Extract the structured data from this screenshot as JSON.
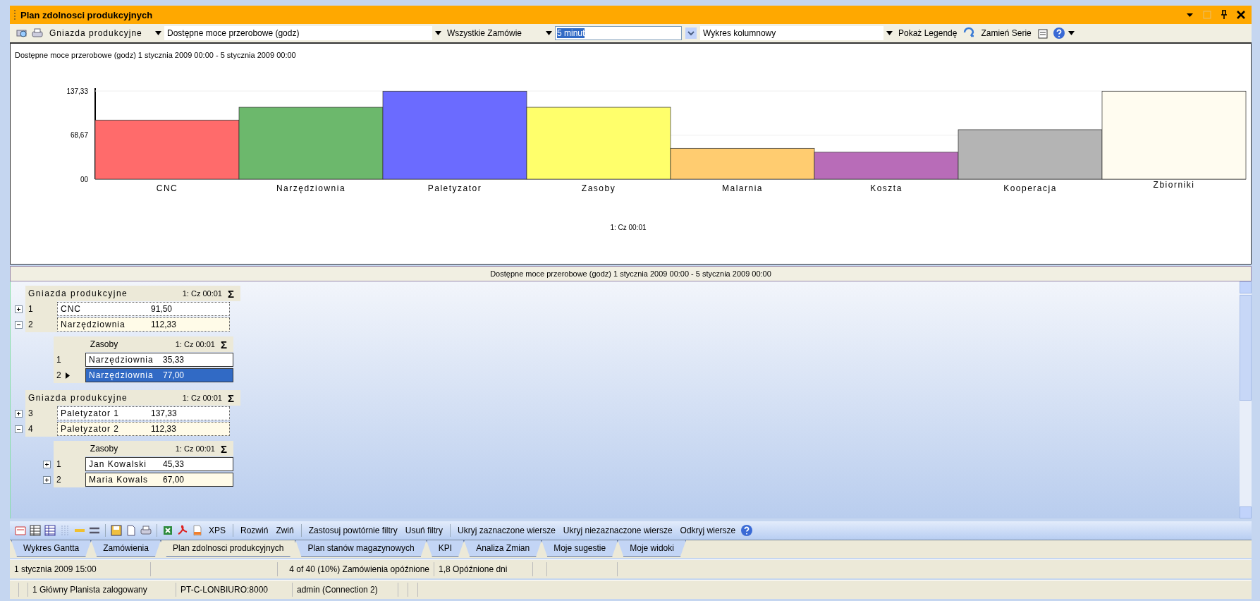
{
  "window": {
    "title": "Plan zdolnosci produkcyjnych"
  },
  "toolbar": {
    "group_by": "Gniazda produkcyjne",
    "measure": "Dostępne moce przerobowe (godz)",
    "orders": "Wszystkie Zamówie",
    "interval": "5 minut",
    "chart_type": "Wykres kolumnowy",
    "buttons": [
      "Pokaż Legendę",
      "Zamień Serie"
    ]
  },
  "chart": {
    "title": "Dostępne moce przerobowe (godz) 1 stycznia 2009  00:00 - 5 stycznia 2009  00:00",
    "chart_data": {
      "type": "bar",
      "categories": [
        "CNC",
        "Narzędziownia",
        "Paletyzator",
        "Zasoby",
        "Malarnia",
        "Koszta",
        "Kooperacja",
        "Zbiorniki"
      ],
      "series": [
        {
          "name": "1: Cz 00:01",
          "colors": [
            "#ff6b6b",
            "#6cb86c",
            "#6b6bff",
            "#ffff6b",
            "#ffcc70",
            "#b86cb8",
            "#b4b4b4",
            "#fffcf0"
          ],
          "values": [
            92,
            112,
            137,
            112,
            48,
            42,
            77,
            137
          ]
        }
      ],
      "ylim": [
        0,
        137.33
      ],
      "yticks": [
        {
          "value": 0,
          "label": "00"
        },
        {
          "value": 68.67,
          "label": "68,67"
        },
        {
          "value": 137.33,
          "label": "137,33"
        }
      ]
    }
  },
  "grid": {
    "caption": "Dostępne moce przerobowe (godz) 1 stycznia 2009  00:00 - 5 stycznia 2009  00:00",
    "groups": [
      {
        "header": {
          "title": "Gniazda produkcyjne",
          "column": "1: Cz 00:01",
          "sigma": "Σ"
        },
        "rows": [
          {
            "number": "1",
            "name": "CNC",
            "value": "91,50",
            "expanded": false
          },
          {
            "number": "2",
            "name": "Narzędziownia",
            "value": "112,33",
            "expanded": true,
            "children": {
              "header": {
                "title": "Zasoby",
                "column": "1: Cz 00:01",
                "sigma": "Σ"
              },
              "rows": [
                {
                  "number": "1",
                  "name": "Narzędziownia",
                  "value": "35,33",
                  "selected": false
                },
                {
                  "number": "2",
                  "name": "Narzędziownia",
                  "value": "77,00",
                  "selected": true
                }
              ]
            }
          }
        ]
      },
      {
        "header": {
          "title": "Gniazda produkcyjne",
          "column": "1: Cz 00:01",
          "sigma": "Σ"
        },
        "rows": [
          {
            "number": "3",
            "name": "Paletyzator 1",
            "value": "137,33",
            "expanded": false
          },
          {
            "number": "4",
            "name": "Paletyzator 2",
            "value": "112,33",
            "expanded": true,
            "children": {
              "header": {
                "title": "Zasoby",
                "column": "1: Cz 00:01",
                "sigma": "Σ"
              },
              "rows": [
                {
                  "number": "1",
                  "name": "Jan Kowalski",
                  "value": "45,33",
                  "expanded": false,
                  "selected": false
                },
                {
                  "number": "2",
                  "name": "Maria Kowals",
                  "value": "67,00",
                  "expanded": false,
                  "selected": false
                }
              ]
            }
          }
        ]
      }
    ]
  },
  "bottom_toolbar": {
    "buttons": [
      "XPS",
      "Rozwiń",
      "Zwiń",
      "Zastosuj powtórnie filtry",
      "Usuń filtry",
      "Ukryj zaznaczone wiersze",
      "Ukryj niezaznaczone wiersze",
      "Odkryj wiersze"
    ]
  },
  "tabs": [
    {
      "label": "Wykres Gantta",
      "selected": false
    },
    {
      "label": "Zamówienia",
      "selected": false
    },
    {
      "label": "Plan zdolnosci produkcyjnych",
      "selected": true
    },
    {
      "label": "Plan stanów magazynowych",
      "selected": false
    },
    {
      "label": "KPI",
      "selected": false
    },
    {
      "label": "Analiza Zmian",
      "selected": false
    },
    {
      "label": "Moje sugestie",
      "selected": false
    },
    {
      "label": "Moje widoki",
      "selected": false
    }
  ],
  "status_bar": {
    "row_1": [
      "1 stycznia 2009 15:00",
      "4 of 40 (10%) Zamówienia opóźnione",
      "1,8 Opóźnione dni"
    ],
    "row_2": [
      "1 Główny Planista zalogowany",
      "PT-C-LONBIURO:8000",
      "admin (Connection 2)"
    ]
  }
}
